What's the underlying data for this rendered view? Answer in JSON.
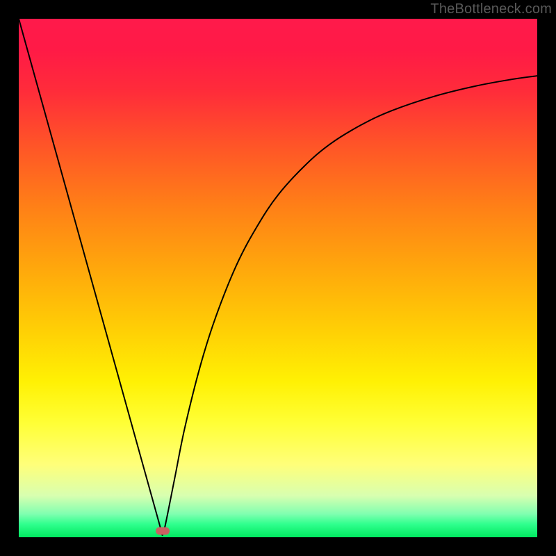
{
  "watermark": "TheBottleneck.com",
  "chart_data": {
    "type": "line",
    "title": "",
    "xlabel": "",
    "ylabel": "",
    "xlim": [
      0,
      100
    ],
    "ylim": [
      0,
      100
    ],
    "grid": false,
    "background_gradient": {
      "stops": [
        {
          "pos": 0.0,
          "color": "#ff1a4b"
        },
        {
          "pos": 0.06,
          "color": "#ff1a46"
        },
        {
          "pos": 0.14,
          "color": "#ff2c3a"
        },
        {
          "pos": 0.24,
          "color": "#ff5328"
        },
        {
          "pos": 0.36,
          "color": "#ff7f17"
        },
        {
          "pos": 0.48,
          "color": "#ffa70c"
        },
        {
          "pos": 0.6,
          "color": "#ffcf05"
        },
        {
          "pos": 0.7,
          "color": "#fff104"
        },
        {
          "pos": 0.78,
          "color": "#ffff36"
        },
        {
          "pos": 0.86,
          "color": "#ffff7a"
        },
        {
          "pos": 0.92,
          "color": "#d8ffb0"
        },
        {
          "pos": 0.955,
          "color": "#80ffb0"
        },
        {
          "pos": 0.975,
          "color": "#2fff8d"
        },
        {
          "pos": 1.0,
          "color": "#00e860"
        }
      ]
    },
    "series": [
      {
        "name": "curve",
        "stroke": "#000000",
        "stroke_width": 2,
        "points": [
          {
            "x": 0.0,
            "y": 100.0
          },
          {
            "x": 27.5,
            "y": 1.2
          },
          {
            "x": 28.0,
            "y": 1.2
          },
          {
            "x": 30.0,
            "y": 11.0
          },
          {
            "x": 32.0,
            "y": 21.0
          },
          {
            "x": 35.0,
            "y": 33.0
          },
          {
            "x": 38.0,
            "y": 42.5
          },
          {
            "x": 42.0,
            "y": 52.5
          },
          {
            "x": 46.0,
            "y": 60.0
          },
          {
            "x": 50.0,
            "y": 66.0
          },
          {
            "x": 55.0,
            "y": 71.5
          },
          {
            "x": 60.0,
            "y": 75.8
          },
          {
            "x": 66.0,
            "y": 79.5
          },
          {
            "x": 72.0,
            "y": 82.3
          },
          {
            "x": 80.0,
            "y": 85.0
          },
          {
            "x": 88.0,
            "y": 87.0
          },
          {
            "x": 95.0,
            "y": 88.3
          },
          {
            "x": 100.0,
            "y": 89.0
          }
        ]
      }
    ],
    "markers": [
      {
        "name": "min-marker",
        "x": 27.7,
        "y": 1.2,
        "color": "#c96262"
      }
    ]
  }
}
